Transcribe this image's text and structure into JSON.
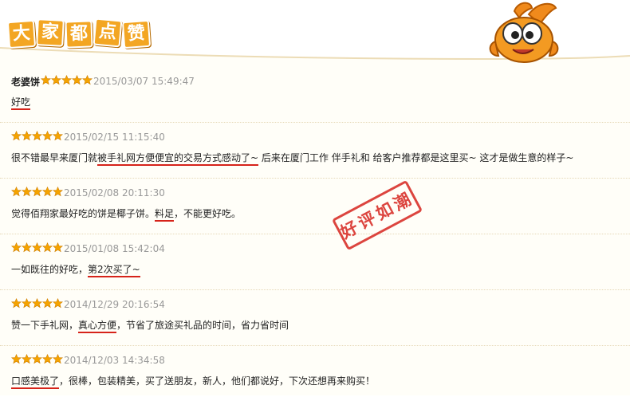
{
  "header": {
    "title_chars": [
      "大",
      "家",
      "都",
      "点",
      "赞"
    ]
  },
  "stamp": {
    "text": "好评如潮"
  },
  "reviews": [
    {
      "author": "老婆饼",
      "stars": 5,
      "date": "2015/03/07 15:49:47",
      "parts": [
        {
          "t": "好吃",
          "u": true
        }
      ]
    },
    {
      "author": "",
      "stars": 5,
      "date": "2015/02/15 11:15:40",
      "parts": [
        {
          "t": "很不错最早来厦门就",
          "u": false
        },
        {
          "t": "被手礼网方便便宜的交易方式感动了~",
          "u": true
        },
        {
          "t": " 后来在厦门工作 伴手礼和 给客户推荐都是这里买~ 这才是做生意的样子~",
          "u": false
        }
      ]
    },
    {
      "author": "",
      "stars": 5,
      "date": "2015/02/08 20:11:30",
      "parts": [
        {
          "t": "觉得佰翔家最好吃的饼是椰子饼。",
          "u": false
        },
        {
          "t": "料足",
          "u": true
        },
        {
          "t": "，不能更好吃。",
          "u": false
        }
      ]
    },
    {
      "author": "",
      "stars": 5,
      "date": "2015/01/08 15:42:04",
      "parts": [
        {
          "t": "一如既往的好吃，",
          "u": false
        },
        {
          "t": "第2次买了~",
          "u": true
        }
      ]
    },
    {
      "author": "",
      "stars": 5,
      "date": "2014/12/29 20:16:54",
      "parts": [
        {
          "t": "赞一下手礼网，",
          "u": false
        },
        {
          "t": "真心方便",
          "u": true
        },
        {
          "t": "，节省了旅途买礼品的时间，省力省时间",
          "u": false
        }
      ]
    },
    {
      "author": "",
      "stars": 5,
      "date": "2014/12/03 14:34:58",
      "parts": [
        {
          "t": "口感美极了",
          "u": true
        },
        {
          "t": "，很棒，包装精美，买了送朋友，新人，他们都说好，下次还想再来购买！",
          "u": false
        }
      ]
    }
  ],
  "colors": {
    "star": "#f5a300",
    "underline": "#d6231a",
    "stamp": "#d9322b",
    "badge": "#f3a623"
  }
}
